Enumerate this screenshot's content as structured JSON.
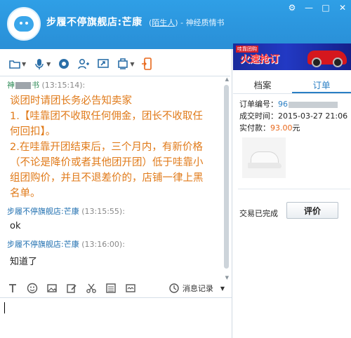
{
  "window": {
    "title": "步履不停旗舰店:芒康",
    "relation": "陌生人",
    "department": "神经质情书"
  },
  "chat": {
    "messages": [
      {
        "sender_prefix": "神",
        "sender_suffix": "书",
        "time": "(13:15:14):",
        "lines": [
          "谈团时请团长务必告知卖家",
          "1.【哇靠团不收取任何佣金，团长不收取任",
          "何回扣】。",
          "2.在哇靠开团结束后，三个月内，有新价格",
          "（不论是降价或者其他团开团）低于哇靠小",
          "组团购价，并且不退差价的，店铺一律上黑",
          "名单。"
        ]
      },
      {
        "sender": "步履不停旗舰店:芒康",
        "time": "(13:15:55):",
        "text": "ok"
      },
      {
        "sender": "步履不停旗舰店:芒康",
        "time": "(13:16:00):",
        "text": "知道了"
      }
    ]
  },
  "input_toolbar": {
    "history_label": "消息记录"
  },
  "ad": {
    "logo": "哇靠团购",
    "slogan": "火速抢订"
  },
  "right_panel": {
    "tabs": [
      "档案",
      "订单"
    ],
    "active_tab": "订单",
    "order": {
      "number_label": "订单编号：",
      "number_value": "96",
      "time_label": "成交时间：",
      "time_value": "2015-03-27 21:06",
      "paid_label": "实付款：",
      "paid_value": "93.00",
      "paid_unit": "元"
    },
    "status": "交易已完成",
    "rate_button": "评价"
  },
  "colors": {
    "titlebar": "#2b95dd",
    "notice_text": "#e07a19",
    "sender_blue": "#1f6fb0",
    "active_tab": "#2a7fc4",
    "price_orange": "#e8671a"
  }
}
